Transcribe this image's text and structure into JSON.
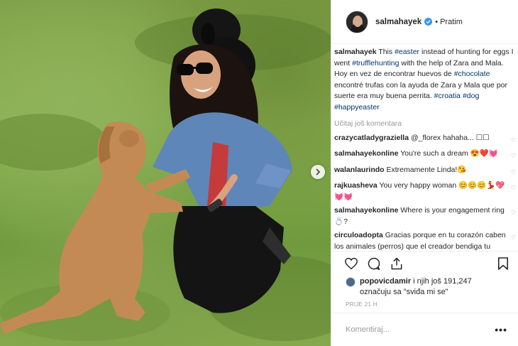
{
  "post": {
    "username": "salmahayek",
    "separator": "•",
    "follow_label": "Pratim",
    "verified": true
  },
  "caption": {
    "user": "salmahayek",
    "parts": [
      {
        "text": " This ",
        "tag": false
      },
      {
        "text": "#easter",
        "tag": true
      },
      {
        "text": " instead of hunting for eggs I went ",
        "tag": false
      },
      {
        "text": "#trufflehunting",
        "tag": true
      },
      {
        "text": " with the help of Zara and Mala. Hoy en vez de encontrar huevos de ",
        "tag": false
      },
      {
        "text": "#chocolate",
        "tag": true
      },
      {
        "text": " encontré trufas con la ayuda de Zara y Mala que por suerte era muy buena perrita. ",
        "tag": false
      },
      {
        "text": "#croatia",
        "tag": true
      },
      {
        "text": " ",
        "tag": false
      },
      {
        "text": "#dog",
        "tag": true
      },
      {
        "text": " ",
        "tag": false
      },
      {
        "text": "#happyeaster",
        "tag": true
      }
    ]
  },
  "load_more_label": "Učitaj još komentara",
  "comments": [
    {
      "user": "crazycatladygraziella",
      "text": " @_florex hahaha... ☐☐"
    },
    {
      "user": "salmahayekonline",
      "text": " You're such a dream 😍❤️💓"
    },
    {
      "user": "walanlaurindo",
      "text": " Extremamente Linda!😘"
    },
    {
      "user": "rajkuasheva",
      "text": " You very happy woman 😊😊😊💃💖💓💓"
    },
    {
      "user": "salmahayekonline",
      "text": " Where is your engagement ring 💍?"
    },
    {
      "user": "circuloadopta",
      "text": " Gracias porque en tu corazón caben los animales (perros) que el creador bendiga tu salud por siempre."
    }
  ],
  "likes": {
    "user": "popovicdamir",
    "rest": " i njih još 191,247",
    "line2": "označuju sa \"sviđa mi se\""
  },
  "time_label": "PRIJE 21 H",
  "comment_input": {
    "placeholder": "Komentiraj..."
  },
  "more_label": "•••",
  "colors": {
    "link": "#003569",
    "verified": "#3897f0",
    "muted": "#999999",
    "text": "#262626"
  },
  "icons": [
    "heart-icon",
    "comment-icon",
    "share-icon",
    "bookmark-icon",
    "verified-icon",
    "chevron-right-icon",
    "more-icon"
  ]
}
